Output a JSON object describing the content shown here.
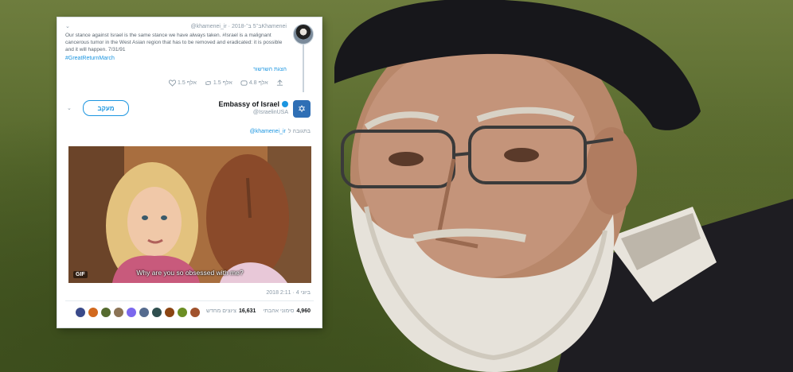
{
  "quoted_tweet": {
    "header": "@khamenei_ir · 2018-ב־5 ב־Khamenei",
    "text": "Our stance against Israel is the same stance we have always taken. #Israel is a malignant cancerous tumor in the West Asian region that has to be removed and eradicated: it is possible and it will happen. 7/31/91",
    "hashtag": "#GreatReturnMarch",
    "show_thread": "הצגת השרשור",
    "actions": {
      "replies": "4.8 אלף",
      "retweets": "1.5 אלף",
      "likes": "1.5 אלף"
    }
  },
  "reply_tweet": {
    "name": "Embassy of Israel",
    "handle": "@IsraelinUSA",
    "follow_label": "מעקב",
    "replying_to_label": "בתגובה ל",
    "replying_to_handle": "@khamenei_ir",
    "media": {
      "badge": "GIF",
      "subtitle": "Why are you so obsessed with me?"
    },
    "timestamp": "2018 ביוני 4 · 2:11",
    "stats": {
      "likes_label": "סימוני אהבתי",
      "likes_count": "4,960",
      "retweets_label": "ציוצים מחדש",
      "retweets_count": "16,631"
    },
    "liker_colors": [
      "#3a4a8a",
      "#d2691e",
      "#556b2f",
      "#8b7355",
      "#7b68ee",
      "#556b8f",
      "#2f4f4f",
      "#8b4513",
      "#6b8e23",
      "#a0522d"
    ]
  },
  "colors": {
    "accent": "#1b95e0",
    "text": "#14171a",
    "muted": "#8a99a6"
  }
}
